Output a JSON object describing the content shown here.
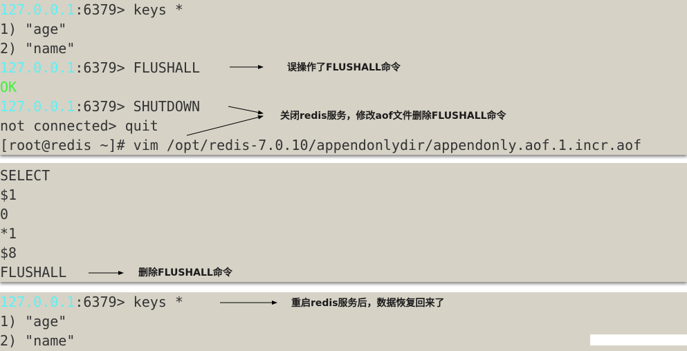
{
  "terminal1": {
    "prompt_ip": "127.0.0.1",
    "prompt_port": ":6379> ",
    "cmd_keys": "keys *",
    "res_age": "1) \"age\"",
    "res_name": "2) \"name\"",
    "cmd_flushall": "FLUSHALL",
    "res_ok": "OK",
    "cmd_shutdown": "SHUTDOWN",
    "line_quit": "not connected> quit",
    "line_vim": "[root@redis ~]# vim /opt/redis-7.0.10/appendonlydir/appendonly.aof.1.incr.aof"
  },
  "terminal2": {
    "l1": "SELECT",
    "l2": "$1",
    "l3": "0",
    "l4": "*1",
    "l5": "$8",
    "l6": "FLUSHALL"
  },
  "terminal3": {
    "prompt_ip": "127.0.0.1",
    "prompt_port": ":6379> ",
    "cmd_keys": "keys *",
    "res_age": "1) \"age\"",
    "res_name": "2) \"name\""
  },
  "annotations": {
    "misoperation": "误操作了FLUSHALL命令",
    "shutdown_edit": "关闭redis服务，修改aof文件删除FLUSHALL命令",
    "delete_cmd": "删除FLUSHALL命令",
    "restored": "重启redis服务后，数据恢复回来了"
  },
  "colors": {
    "terminal_bg": "#d6d2c6",
    "text": "#333333",
    "prompt_ip": "#5ff0f2",
    "ok": "#3ff03c"
  }
}
